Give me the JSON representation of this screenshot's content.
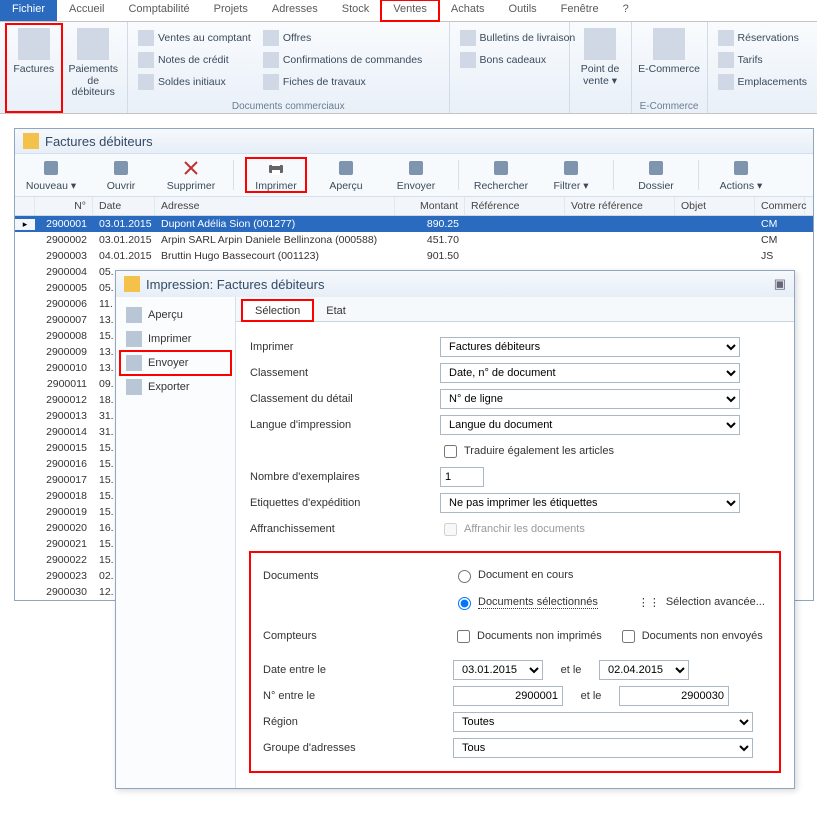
{
  "menu": {
    "items": [
      "Fichier",
      "Accueil",
      "Comptabilité",
      "Projets",
      "Adresses",
      "Stock",
      "Ventes",
      "Achats",
      "Outils",
      "Fenêtre",
      "?"
    ],
    "active_index": 0,
    "highlight_index": 6
  },
  "ribbon": {
    "group1_big": [
      {
        "label": "Factures",
        "hl": true
      },
      {
        "label": "Paiements de\ndébiteurs"
      }
    ],
    "group1_list": [
      "Ventes au comptant",
      "Notes de crédit",
      "Soldes initiaux"
    ],
    "group2_list": [
      "Offres",
      "Confirmations de commandes",
      "Fiches de travaux"
    ],
    "group2_label": "Documents commerciaux",
    "group3_list": [
      "Bulletins de livraison",
      "Bons cadeaux"
    ],
    "group4_big": [
      {
        "label": "Point de\nvente ▾"
      }
    ],
    "group5_big": [
      {
        "label": "E-Commerce"
      }
    ],
    "group5_label": "E-Commerce",
    "group6_list": [
      "Réservations",
      "Tarifs",
      "Emplacements"
    ]
  },
  "win": {
    "title": "Factures débiteurs"
  },
  "toolbar": {
    "items": [
      {
        "label": "Nouveau",
        "name": "new-button",
        "arrow": true
      },
      {
        "label": "Ouvrir",
        "name": "open-button"
      },
      {
        "label": "Supprimer",
        "name": "delete-button"
      },
      {
        "sep": true
      },
      {
        "label": "Imprimer",
        "name": "print-button",
        "hl": true
      },
      {
        "label": "Aperçu",
        "name": "preview-button"
      },
      {
        "label": "Envoyer",
        "name": "send-button"
      },
      {
        "sep": true
      },
      {
        "label": "Rechercher",
        "name": "search-button"
      },
      {
        "label": "Filtrer",
        "name": "filter-button",
        "arrow": true
      },
      {
        "sep": true
      },
      {
        "label": "Dossier",
        "name": "folder-button"
      },
      {
        "sep": true
      },
      {
        "label": "Actions",
        "name": "actions-button",
        "arrow": true
      }
    ]
  },
  "grid": {
    "headers": [
      "N°",
      "Date",
      "Adresse",
      "Montant",
      "Référence",
      "Votre référence",
      "Objet",
      "Commerc"
    ],
    "rows": [
      {
        "num": "2900001",
        "date": "03.01.2015",
        "addr": "Dupont Adélia Sion (001277)",
        "mont": "890.25",
        "com": "CM",
        "sel": true
      },
      {
        "num": "2900002",
        "date": "03.01.2015",
        "addr": "Arpin SARL Arpin Daniele Bellinzona (000588)",
        "mont": "451.70",
        "com": "CM"
      },
      {
        "num": "2900003",
        "date": "04.01.2015",
        "addr": "Bruttin Hugo Bassecourt (001123)",
        "mont": "901.50",
        "com": "JS"
      },
      {
        "num": "2900004",
        "date": "05."
      },
      {
        "num": "2900005",
        "date": "05."
      },
      {
        "num": "2900006",
        "date": "11."
      },
      {
        "num": "2900007",
        "date": "13."
      },
      {
        "num": "2900008",
        "date": "15."
      },
      {
        "num": "2900009",
        "date": "13."
      },
      {
        "num": "2900010",
        "date": "13."
      },
      {
        "num": "2900011",
        "date": "09."
      },
      {
        "num": "2900012",
        "date": "18."
      },
      {
        "num": "2900013",
        "date": "31."
      },
      {
        "num": "2900014",
        "date": "31."
      },
      {
        "num": "2900015",
        "date": "15."
      },
      {
        "num": "2900016",
        "date": "15."
      },
      {
        "num": "2900017",
        "date": "15."
      },
      {
        "num": "2900018",
        "date": "15."
      },
      {
        "num": "2900019",
        "date": "15."
      },
      {
        "num": "2900020",
        "date": "16."
      },
      {
        "num": "2900021",
        "date": "15."
      },
      {
        "num": "2900022",
        "date": "15."
      },
      {
        "num": "2900023",
        "date": "02."
      },
      {
        "num": "2900030",
        "date": "12."
      }
    ]
  },
  "dialog": {
    "title": "Impression: Factures débiteurs",
    "side_items": [
      "Aperçu",
      "Imprimer",
      "Envoyer",
      "Exporter"
    ],
    "side_hl_index": 2,
    "tabs": [
      "Sélection",
      "Etat"
    ],
    "tab_active": 0,
    "form": {
      "labels": {
        "imprimer": "Imprimer",
        "classement": "Classement",
        "classdet": "Classement du détail",
        "langue": "Langue d'impression",
        "tradart": "Traduire également les articles",
        "nbex": "Nombre d'exemplaires",
        "etiq": "Etiquettes d'expédition",
        "affr": "Affranchissement",
        "affropt": "Affranchir les documents",
        "docs": "Documents",
        "doc_en_cours": "Document en cours",
        "doc_sel": "Documents sélectionnés",
        "sel_av": "Sélection avancée...",
        "compteurs": "Compteurs",
        "nonimp": "Documents non imprimés",
        "nonenv": "Documents non envoyés",
        "date_entre": "Date entre le",
        "et_le": "et le",
        "num_entre": "N° entre le",
        "region": "Région",
        "groupe": "Groupe d'adresses"
      },
      "values": {
        "imprimer": "Factures débiteurs",
        "classement": "Date, n° de document",
        "classdet": "N° de ligne",
        "langue": "Langue du document",
        "nbex": "1",
        "etiq": "Ne pas imprimer les étiquettes",
        "date_from": "03.01.2015",
        "date_to": "02.04.2015",
        "num_from": "2900001",
        "num_to": "2900030",
        "region": "Toutes",
        "groupe": "Tous"
      }
    }
  }
}
